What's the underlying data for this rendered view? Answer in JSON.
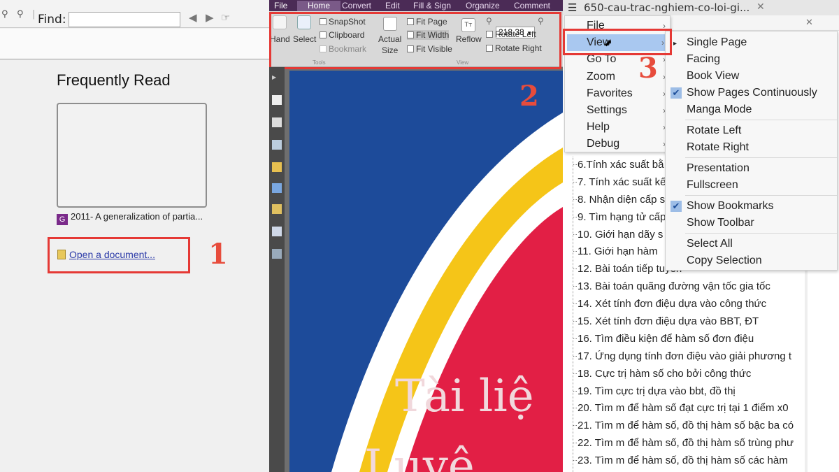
{
  "panel1": {
    "find_label": "Find:",
    "find_value": "",
    "frequently_read_title": "Frequently Read",
    "recent_file": "2011- A generalization of partia...",
    "open_document": "Open a document...",
    "step_number": "1"
  },
  "panel2": {
    "tabs": [
      "File",
      "Home",
      "Convert",
      "Edit",
      "Fill & Sign",
      "Organize",
      "Comment"
    ],
    "ribbon": {
      "hand": "Hand",
      "select": "Select",
      "snapshot": "SnapShot",
      "clipboard": "Clipboard",
      "bookmark": "Bookmark",
      "tools_group": "Tools",
      "actual_size_1": "Actual",
      "actual_size_2": "Size",
      "fit_page": "Fit Page",
      "fit_width": "Fit Width",
      "fit_visible": "Fit Visible",
      "reflow": "Reflow",
      "zoom_value": "218.38",
      "rotate_left": "Rotate Left",
      "rotate_right": "Rotate Right",
      "view_group": "View"
    },
    "doc_title_line1": "Tài liệ",
    "doc_title_line2": "Luyệ",
    "step_number": "2"
  },
  "panel3": {
    "window_title": "650-cau-trac-nghiem-co-loi-gi...",
    "menu": [
      "File",
      "View",
      "Go To",
      "Zoom",
      "Favorites",
      "Settings",
      "Help",
      "Debug"
    ],
    "menu_selected": "View",
    "view_submenu": [
      {
        "label": "Single Page",
        "mark": "bullet"
      },
      {
        "label": "Facing",
        "mark": ""
      },
      {
        "label": "Book View",
        "mark": ""
      },
      {
        "label": "Show Pages Continuously",
        "mark": "check"
      },
      {
        "label": "Manga Mode",
        "mark": ""
      },
      {
        "label": "Rotate Left",
        "mark": ""
      },
      {
        "label": "Rotate Right",
        "mark": ""
      },
      {
        "label": "Presentation",
        "mark": ""
      },
      {
        "label": "Fullscreen",
        "mark": ""
      },
      {
        "label": "Show Bookmarks",
        "mark": "check"
      },
      {
        "label": "Show Toolbar",
        "mark": ""
      },
      {
        "label": "Select All",
        "mark": ""
      },
      {
        "label": "Copy Selection",
        "mark": ""
      }
    ],
    "toc": [
      "6.Tính xác suất bằ",
      "7. Tính xác suất kế",
      "8. Nhận diện cấp s",
      "9. Tìm hạng tử cấp",
      "10. Giới hạn dãy s",
      "11. Giới hạn hàm",
      "12. Bài toán tiếp tuyến",
      "13. Bài toán quãng đường vận tốc gia tốc",
      "14. Xét tính đơn điệu dựa vào công thức",
      "15. Xét tính đơn điệu dựa vào BBT, ĐT",
      "16. Tìm điều kiện để hàm số đơn điệu",
      "17. Ứng dụng tính đơn điệu vào giải phương t",
      "18. Cực trị hàm số cho bởi công thức",
      "19. Tìm cực trị dựa vào bbt, đồ thị",
      "20. Tìm m để hàm số đạt cực trị tại 1 điểm x0",
      "21. Tìm m để hàm số, đồ thị hàm số bậc ba có",
      "22. Tìm m để hàm số, đồ thị hàm số trùng phư",
      "23. Tìm m để hàm số, đồ thị hàm số các hàm"
    ],
    "step_number": "3"
  },
  "colors": {
    "accent_red": "#e53935",
    "ribbon_purple": "#4b2b56",
    "menu_highlight": "#a9c8f0"
  }
}
